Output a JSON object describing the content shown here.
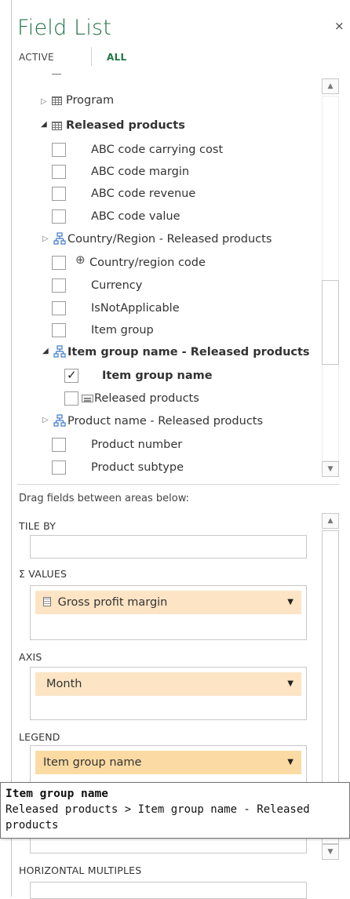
{
  "header": {
    "title": "Field List",
    "close_glyph": "×"
  },
  "tabs": {
    "active_label": "ACTIVE",
    "all_label": "ALL",
    "selected": "ALL"
  },
  "fields": {
    "program": {
      "label": "Program"
    },
    "released_products": {
      "label": "Released products",
      "items": [
        {
          "label": "ABC code carrying cost"
        },
        {
          "label": "ABC code margin"
        },
        {
          "label": "ABC code revenue"
        },
        {
          "label": "ABC code value"
        }
      ],
      "country_hierarchy": {
        "label": "Country/Region - Released products"
      },
      "country_code": {
        "label": "Country/region code"
      },
      "items2": [
        {
          "label": "Currency"
        },
        {
          "label": "IsNotApplicable"
        },
        {
          "label": "Item group"
        }
      ],
      "item_group_hierarchy": {
        "label": "Item group name - Released products",
        "item_group_name": {
          "label": "Item group name",
          "checked": true
        },
        "released_products_attr": {
          "label": "Released products"
        }
      },
      "product_name_hierarchy": {
        "label": "Product name - Released products"
      },
      "items3": [
        {
          "label": "Product number"
        },
        {
          "label": "Product subtype"
        }
      ]
    }
  },
  "areas": {
    "instructions": "Drag fields between areas below:",
    "tile_by": {
      "label": "TILE BY"
    },
    "values": {
      "sigma": "Σ",
      "label": "VALUES",
      "field": "Gross profit margin"
    },
    "axis": {
      "label": "AXIS",
      "field": "Month"
    },
    "legend": {
      "label": "LEGEND",
      "field": "Item group name"
    },
    "horizontal_multiples": {
      "label": "HORIZONTAL MULTIPLES"
    }
  },
  "tooltip": {
    "title": "Item group name",
    "path_line1": "Released products > Item group name - Released",
    "path_line2": "products"
  },
  "colors": {
    "accent": "#217346",
    "pill": "#fce4c4"
  },
  "icons": {
    "table": "table-icon",
    "hierarchy": "hierarchy-icon",
    "globe": "globe-icon",
    "attribute": "attribute-icon",
    "dropdown": "dropdown-arrow-icon"
  }
}
